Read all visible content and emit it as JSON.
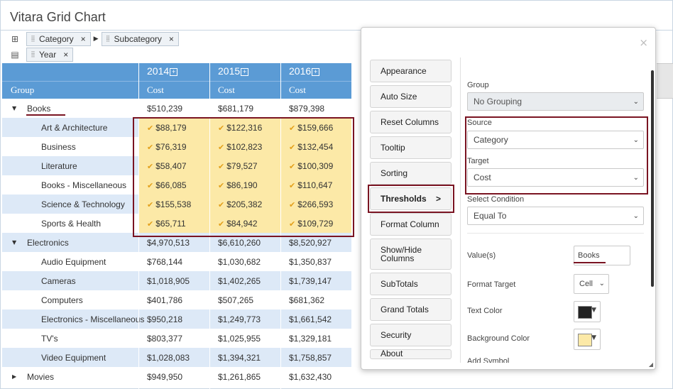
{
  "app": {
    "title": "Vitara Grid Chart"
  },
  "pivot": {
    "row_icon": "tree-icon",
    "row_pills": [
      {
        "label": "Category",
        "close": "×"
      },
      {
        "label": "Subcategory",
        "close": "×"
      }
    ],
    "column_icon": "columns-icon",
    "column_pills": [
      {
        "label": "Year",
        "close": "×"
      }
    ]
  },
  "grid": {
    "years": [
      "2014",
      "2015",
      "2016"
    ],
    "group_label": "Group",
    "measure_labels": [
      "Cost",
      "Cost",
      "Cost"
    ],
    "rows": [
      {
        "level": 0,
        "label": "Books",
        "expanded": true,
        "values": [
          "$510,239",
          "$681,179",
          "$879,398"
        ]
      },
      {
        "level": 1,
        "label": "Art & Architecture",
        "values": [
          "$88,179",
          "$122,316",
          "$159,666"
        ],
        "flag": true
      },
      {
        "level": 1,
        "label": "Business",
        "values": [
          "$76,319",
          "$102,823",
          "$132,454"
        ],
        "flag": true
      },
      {
        "level": 1,
        "label": "Literature",
        "values": [
          "$58,407",
          "$79,527",
          "$100,309"
        ],
        "flag": true
      },
      {
        "level": 1,
        "label": "Books - Miscellaneous",
        "values": [
          "$66,085",
          "$86,190",
          "$110,647"
        ],
        "flag": true
      },
      {
        "level": 1,
        "label": "Science & Technology",
        "values": [
          "$155,538",
          "$205,382",
          "$266,593"
        ],
        "flag": true
      },
      {
        "level": 1,
        "label": "Sports & Health",
        "values": [
          "$65,711",
          "$84,942",
          "$109,729"
        ],
        "flag": true
      },
      {
        "level": 0,
        "label": "Electronics",
        "expanded": true,
        "values": [
          "$4,970,513",
          "$6,610,260",
          "$8,520,927"
        ]
      },
      {
        "level": 1,
        "label": "Audio Equipment",
        "values": [
          "$768,144",
          "$1,030,682",
          "$1,350,837"
        ]
      },
      {
        "level": 1,
        "label": "Cameras",
        "values": [
          "$1,018,905",
          "$1,402,265",
          "$1,739,147"
        ]
      },
      {
        "level": 1,
        "label": "Computers",
        "values": [
          "$401,786",
          "$507,265",
          "$681,362"
        ]
      },
      {
        "level": 1,
        "label": "Electronics - Miscellaneous",
        "values": [
          "$950,218",
          "$1,249,773",
          "$1,661,542"
        ]
      },
      {
        "level": 1,
        "label": "TV's",
        "values": [
          "$803,377",
          "$1,025,955",
          "$1,329,181"
        ]
      },
      {
        "level": 1,
        "label": "Video Equipment",
        "values": [
          "$1,028,083",
          "$1,394,321",
          "$1,758,857"
        ]
      },
      {
        "level": 0,
        "label": "Movies",
        "expanded": false,
        "values": [
          "$949,950",
          "$1,261,865",
          "$1,632,430"
        ]
      }
    ],
    "highlight_color": "#fce9a7",
    "header_color": "#5b9bd5",
    "alt_row_color": "#dde9f7"
  },
  "dialog": {
    "close": "×",
    "tabs": [
      "Appearance",
      "Auto Size",
      "Reset Columns",
      "Tooltip",
      "Sorting",
      "Thresholds",
      "Format Column",
      "Show/Hide Columns",
      "SubTotals",
      "Grand Totals",
      "Security",
      "About"
    ],
    "active_tab_chevron": ">",
    "group_label": "Group",
    "group_value": "No Grouping",
    "source_label": "Source",
    "source_value": "Category",
    "target_label": "Target",
    "target_value": "Cost",
    "condition_label": "Select Condition",
    "condition_value": "Equal To",
    "values_label": "Value(s)",
    "values_value": "Books",
    "format_target_label": "Format Target",
    "format_target_value": "Cell",
    "text_color_label": "Text Color",
    "text_color": "#222222",
    "bg_color_label": "Background Color",
    "bg_color": "#fce9a7",
    "add_symbol_label": "Add Symbol"
  },
  "accent_color": "#7a1422"
}
